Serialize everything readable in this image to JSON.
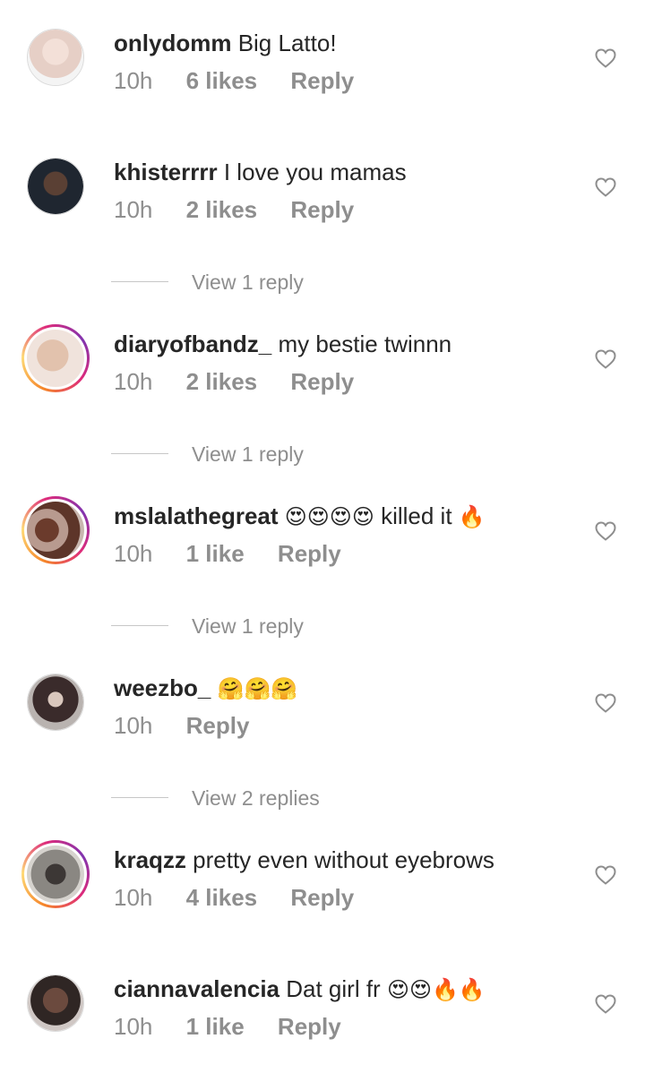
{
  "comments": [
    {
      "username": "onlydomm",
      "text": "Big Latto!",
      "emojis": "",
      "time": "10h",
      "likes": "6 likes",
      "reply": "Reply",
      "avatar_color": "#e9d6cf"
    },
    {
      "username": "khisterrrr",
      "text": "I love you mamas",
      "emojis": "",
      "time": "10h",
      "likes": "2 likes",
      "reply": "Reply",
      "avatar_color": "#2b2f3a"
    },
    {
      "username": "diaryofbandz_",
      "text": "my bestie twinnn",
      "emojis": "",
      "time": "10h",
      "likes": "2 likes",
      "reply": "Reply",
      "avatar_color": "#d9b9a0"
    },
    {
      "username": "mslalathegreat",
      "text": "killed it",
      "emojis": "😍😍😍😍",
      "emojis_after": "🔥",
      "time": "10h",
      "likes": "1 like",
      "reply": "Reply",
      "avatar_color": "#7a4a3a"
    },
    {
      "username": "weezbo_",
      "text": "",
      "emojis": "🤗🤗🤗",
      "time": "10h",
      "likes": "",
      "reply": "Reply",
      "avatar_color": "#4a3a3a"
    },
    {
      "username": "kraqzz",
      "text": "pretty even without eyebrows",
      "emojis": "",
      "time": "10h",
      "likes": "4 likes",
      "reply": "Reply",
      "avatar_color": "#7d7b76"
    },
    {
      "username": "ciannavalencia",
      "text": "Dat girl fr",
      "emojis": "😍😍🔥🔥",
      "time": "10h",
      "likes": "1 like",
      "reply": "Reply",
      "avatar_color": "#5a3e34"
    }
  ],
  "view_replies": [
    {
      "label": "View 1 reply"
    },
    {
      "label": "View 1 reply"
    },
    {
      "label": "View 1 reply"
    },
    {
      "label": "View 2 replies"
    }
  ],
  "colors": {
    "text": "#262626",
    "muted": "#8e8e8e",
    "heart": "#8e8e8e"
  },
  "icons": {
    "like": "heart-outline-icon"
  }
}
